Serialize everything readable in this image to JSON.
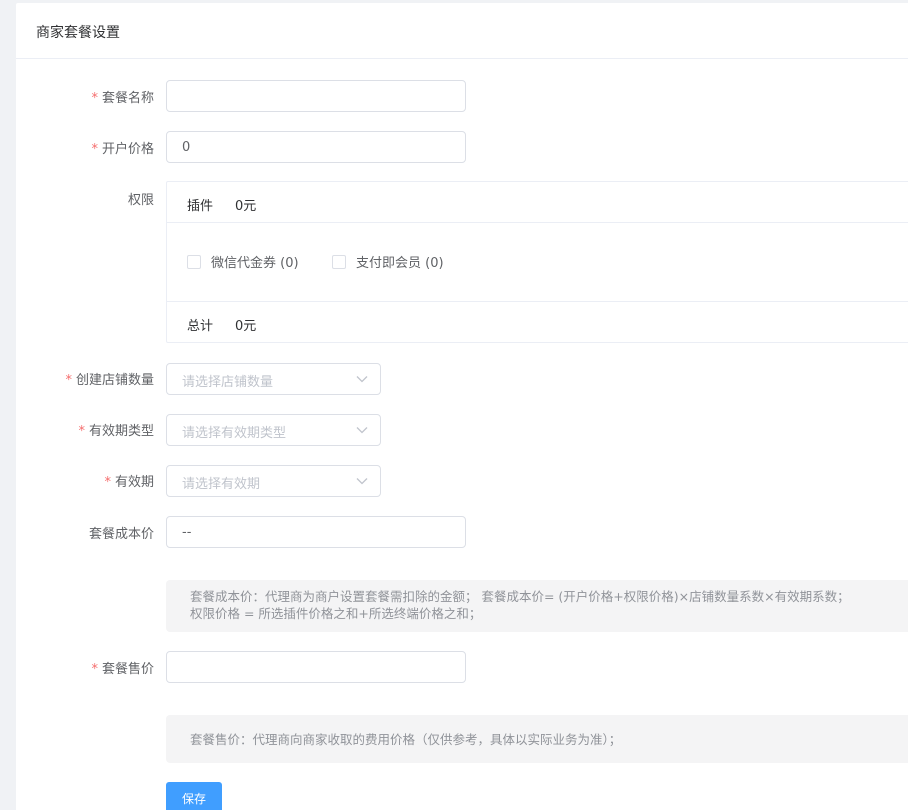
{
  "header": {
    "title": "商家套餐设置"
  },
  "form": {
    "name": {
      "label": "套餐名称",
      "required": true,
      "value": ""
    },
    "open_price": {
      "label": "开户价格",
      "required": true,
      "value": "0"
    },
    "permissions": {
      "label": "权限",
      "plugin_key": "插件",
      "plugin_value": "0元",
      "options": [
        {
          "label": "微信代金券 (0)",
          "checked": false
        },
        {
          "label": "支付即会员 (0)",
          "checked": false
        }
      ],
      "total_key": "总计",
      "total_value": "0元"
    },
    "store_count": {
      "label": "创建店铺数量",
      "required": true,
      "placeholder": "请选择店铺数量"
    },
    "validity_type": {
      "label": "有效期类型",
      "required": true,
      "placeholder": "请选择有效期类型"
    },
    "validity": {
      "label": "有效期",
      "required": true,
      "placeholder": "请选择有效期"
    },
    "cost_price": {
      "label": "套餐成本价",
      "required": false,
      "value": "--"
    },
    "cost_tip": {
      "line1": "套餐成本价：代理商为商户设置套餐需扣除的金额； 套餐成本价= (开户价格+权限价格)×店铺数量系数×有效期系数；",
      "line2": "权限价格 = 所选插件价格之和+所选终端价格之和；"
    },
    "sale_price": {
      "label": "套餐售价",
      "required": true,
      "value": ""
    },
    "sale_tip": {
      "line1": "套餐售价：代理商向商家收取的费用价格（仅供参考，具体以实际业务为准）；"
    },
    "save_button": "保存"
  },
  "colors": {
    "required_mark": "#f56c6c",
    "primary": "#409eff",
    "placeholder": "#c0c4cc",
    "tip_background": "#f4f4f5"
  }
}
